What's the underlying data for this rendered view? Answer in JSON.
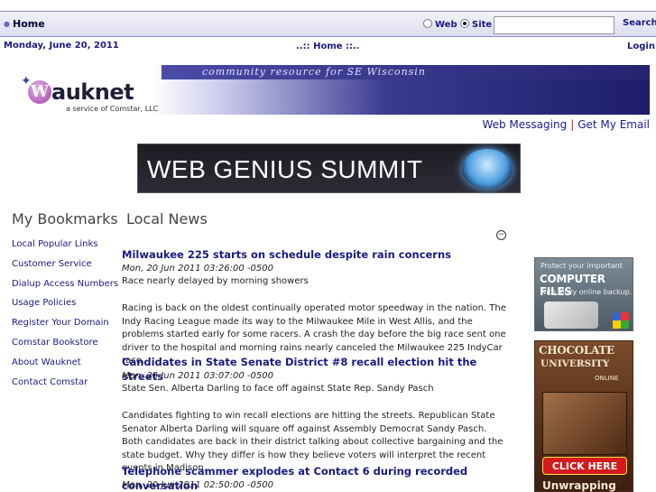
{
  "topbar": {
    "home_label": "Home",
    "search_options": [
      {
        "label": "Web",
        "selected": false
      },
      {
        "label": "Site",
        "selected": true
      }
    ],
    "search_value": "",
    "search_button": "Search"
  },
  "daterow": {
    "date": "Monday, June 20, 2011",
    "breadcrumb": "..:: Home ::..",
    "login": "Login"
  },
  "banner": {
    "tagline": "community resource for SE Wisconsin",
    "logo_word": "auknet",
    "logo_letter": "W",
    "logo_sub": "a service of Comstar, LLC"
  },
  "email_links": {
    "web_messaging": "Web Messaging",
    "separator": "|",
    "get_email": "Get My Email"
  },
  "summit_ad": {
    "text": "WEB GENIUS SUMMIT"
  },
  "sections": {
    "bookmarks_title": "My Bookmarks",
    "news_title": "Local News",
    "collapse_symbol": "−"
  },
  "bookmarks": [
    "Local Popular Links",
    "Customer Service",
    "Dialup Access Numbers",
    "Usage Policies",
    "Register Your Domain",
    "Comstar Bookstore",
    "About Wauknet",
    "Contact Comstar"
  ],
  "news": [
    {
      "title": "Milwaukee 225 starts on schedule despite rain concerns",
      "meta": "Mon, 20 Jun 2011 03:26:00 -0500",
      "summary": "Race nearly delayed by morning showers",
      "body": "Racing is back on the oldest continually operated motor speedway in the nation. The Indy Racing League made its way to the Milwaukee Mile in West Allis, and the problems started early for some racers. A crash the day before the big race sent one driver to the hospital and morning rains nearly canceled the Milwaukee 225 IndyCar race."
    },
    {
      "title": "Candidates in State Senate District #8 recall election hit the streets",
      "meta": "Mon, 20 Jun 2011 03:07:00 -0500",
      "summary": "State Sen. Alberta Darling to face off against State Rep. Sandy Pasch",
      "body": "Candidates fighting to win recall elections are hitting the streets. Republican State Senator Alberta Darling will square off against Assembly Democrat Sandy Pasch. Both candidates are back in their district talking about collective bargaining and the state budget. Why they differ is how they believe voters will interpret the recent events in Madison."
    },
    {
      "title": "Telephone scammer explodes at Contact 6 during recorded conversation",
      "meta": "Mon, 20 Jun 2011 02:50:00 -0500",
      "summary": "",
      "body": ""
    }
  ],
  "ads": {
    "mozy": {
      "line1": "Protect your important",
      "line2": "COMPUTER FILES",
      "line3": "with Mozy online backup."
    },
    "chocolate": {
      "line1": "CHOCOLATE",
      "line2": "UNIVERSITY",
      "line3": "ONLINE",
      "button": "CLICK HERE",
      "line4": "Unwrapping"
    }
  }
}
